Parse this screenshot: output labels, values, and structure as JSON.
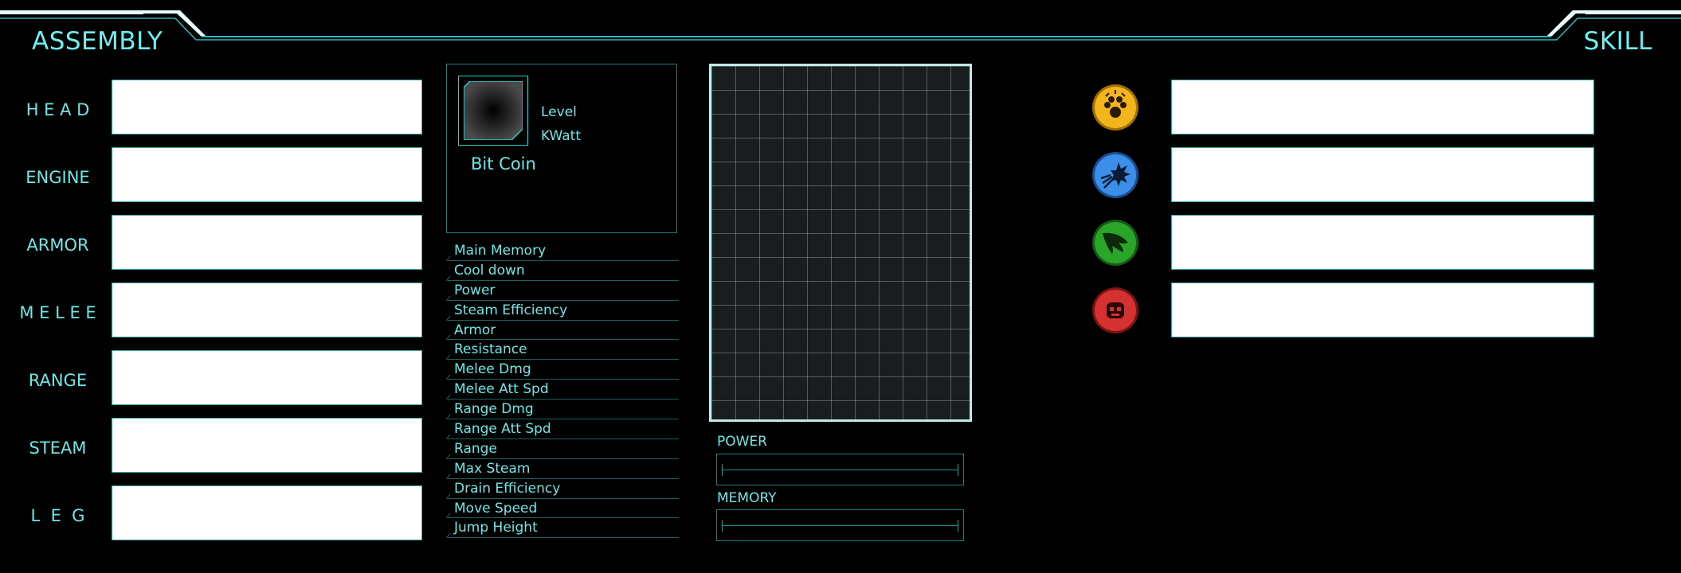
{
  "assembly": {
    "title": "ASSEMBLY",
    "slots": [
      {
        "label": "H E A D",
        "value": ""
      },
      {
        "label": "ENGINE",
        "value": ""
      },
      {
        "label": "ARMOR",
        "value": ""
      },
      {
        "label": "M E L E E",
        "value": ""
      },
      {
        "label": "RANGE",
        "value": ""
      },
      {
        "label": "STEAM",
        "value": ""
      },
      {
        "label": "L  E  G",
        "value": ""
      }
    ]
  },
  "info": {
    "level_label": "Level",
    "kwatt_label": "KWatt",
    "bitcoin_label": "Bit Coin"
  },
  "stats": [
    {
      "label": "Main Memory"
    },
    {
      "label": "Cool down"
    },
    {
      "label": "Power"
    },
    {
      "label": "Steam Efficiency"
    },
    {
      "label": "Armor"
    },
    {
      "label": "Resistance"
    },
    {
      "label": "Melee Dmg"
    },
    {
      "label": "Melee Att Spd"
    },
    {
      "label": "Range Dmg"
    },
    {
      "label": "Range Att Spd"
    },
    {
      "label": "Range"
    },
    {
      "label": "Max Steam"
    },
    {
      "label": "Drain Efficiency"
    },
    {
      "label": "Move Speed"
    },
    {
      "label": "Jump Height"
    }
  ],
  "meters": {
    "power": {
      "label": "POWER",
      "value_fraction": 0
    },
    "memory": {
      "label": "MEMORY",
      "value_fraction": 0
    }
  },
  "skill": {
    "title": "SKILL",
    "slots": [
      {
        "icon": "paw-claw-icon",
        "color": "#f2b51c",
        "value": ""
      },
      {
        "icon": "burst-blast-icon",
        "color": "#3b8fe8",
        "value": ""
      },
      {
        "icon": "wing-feather-icon",
        "color": "#2aa52a",
        "value": ""
      },
      {
        "icon": "robot-face-icon",
        "color": "#d63131",
        "value": ""
      }
    ]
  },
  "colors": {
    "accent": "#6fe6e6",
    "frame": "#2bb8b8",
    "background": "#000000"
  }
}
